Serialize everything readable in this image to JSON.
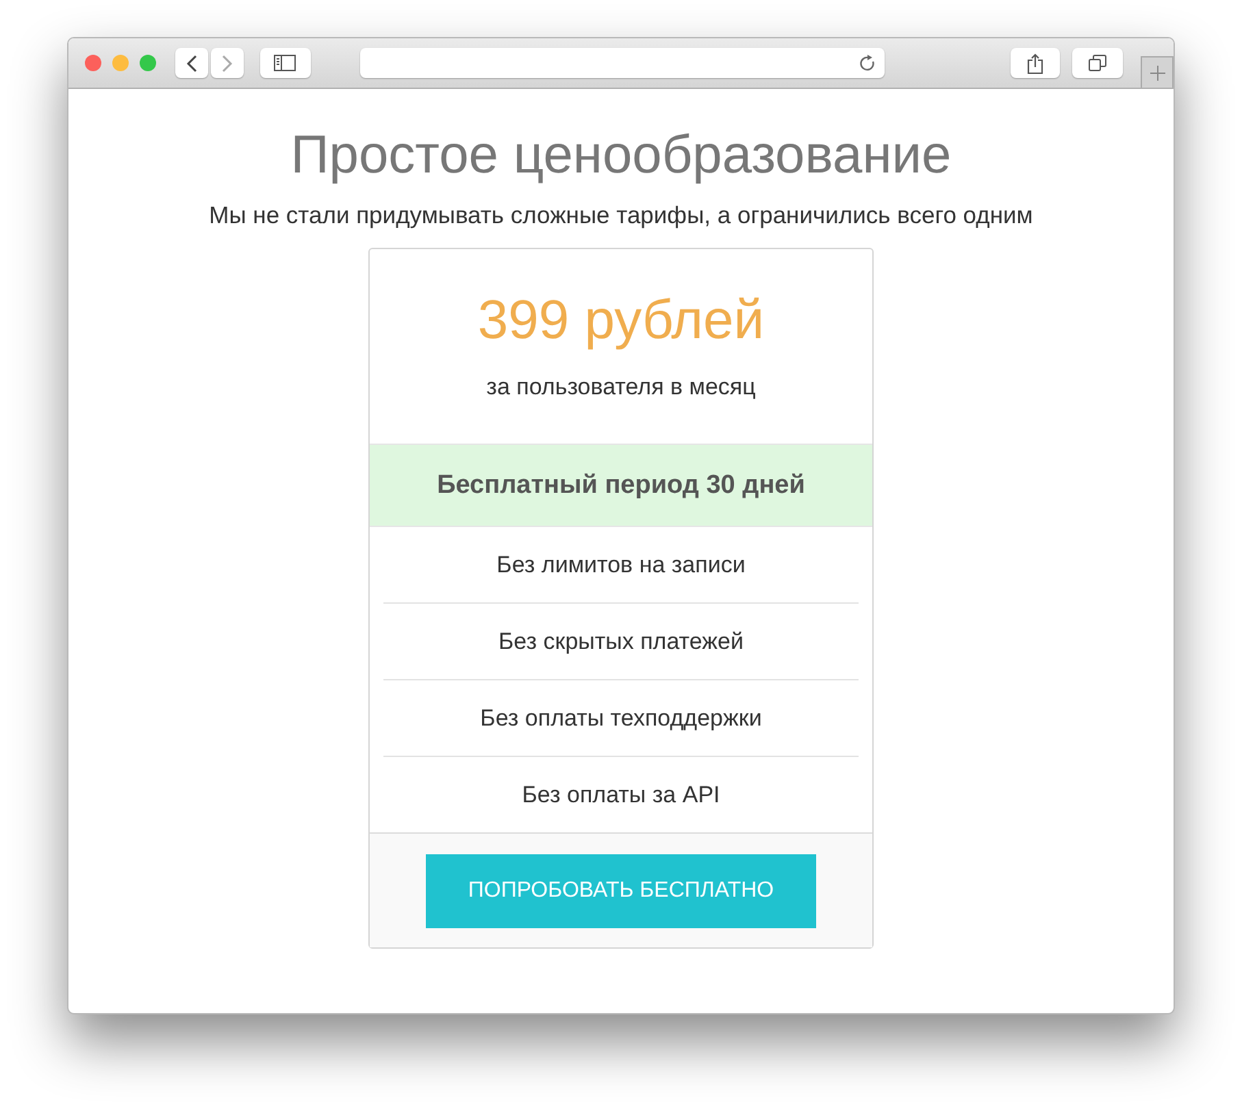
{
  "browser": {
    "back": {
      "disabled": false
    },
    "forward": {
      "disabled": true
    }
  },
  "heading": "Простое ценообразование",
  "subtitle": "Мы не стали придумывать сложные тарифы, а ограничились всего одним",
  "plan": {
    "price": "399 рублей",
    "period": "за пользователя в месяц",
    "highlight": "Бесплатный период 30 дней",
    "features": [
      "Без лимитов на записи",
      "Без скрытых платежей",
      "Без оплаты техподдержки",
      "Без оплаты за API"
    ],
    "button": "ПОПРОБОВАТЬ БЕСПЛАТНО"
  }
}
